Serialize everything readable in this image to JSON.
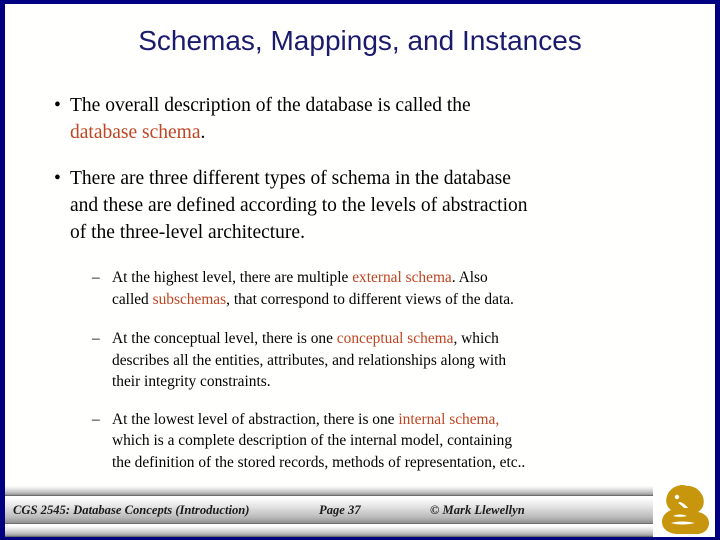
{
  "slide": {
    "title": "Schemas, Mappings, and Instances",
    "title_color": "#1b1b6e",
    "highlight_color": "#bf4422",
    "frame_color": "#000080",
    "background": "#fffffd"
  },
  "bullets": [
    {
      "marker": "•",
      "level": 1,
      "lines": [
        [
          {
            "text": "The  overall  description  of  the  database  is  called  the",
            "color": "default"
          }
        ],
        [
          {
            "text": "database schema",
            "color": "highlight"
          },
          {
            "text": ".",
            "color": "default"
          }
        ]
      ]
    },
    {
      "marker": "•",
      "level": 1,
      "lines": [
        [
          {
            "text": "There are three different types of schema in the database",
            "color": "default"
          }
        ],
        [
          {
            "text": "and these are defined according to the levels of abstraction",
            "color": "default"
          }
        ],
        [
          {
            "text": "of the three-level architecture.",
            "color": "default"
          }
        ]
      ]
    },
    {
      "marker": "–",
      "level": 2,
      "lines": [
        [
          {
            "text": "At  the  highest  level,  there  are  multiple  ",
            "color": "default"
          },
          {
            "text": "external  schema",
            "color": "highlight"
          },
          {
            "text": ".   Also",
            "color": "default"
          }
        ],
        [
          {
            "text": "called ",
            "color": "default"
          },
          {
            "text": "subschemas",
            "color": "highlight"
          },
          {
            "text": ", that correspond to different views of the data.",
            "color": "default"
          }
        ]
      ]
    },
    {
      "marker": "–",
      "level": 2,
      "lines": [
        [
          {
            "text": "At  the  conceptual  level,  there  is  one  ",
            "color": "default"
          },
          {
            "text": "conceptual  schema",
            "color": "highlight"
          },
          {
            "text": ",  which",
            "color": "default"
          }
        ],
        [
          {
            "text": "describes  all  the  entities,  attributes,  and  relationships  along  with",
            "color": "default"
          }
        ],
        [
          {
            "text": "their integrity constraints.",
            "color": "default"
          }
        ]
      ]
    },
    {
      "marker": "–",
      "level": 2,
      "lines": [
        [
          {
            "text": "At  the  lowest  level  of  abstraction,  there  is  one  ",
            "color": "default"
          },
          {
            "text": "internal  schema,",
            "color": "highlight"
          }
        ],
        [
          {
            "text": "which  is  a  complete  description  of  the  internal  model,  containing",
            "color": "default"
          }
        ],
        [
          {
            "text": "the definition of the stored records, methods of representation, etc..",
            "color": "default"
          }
        ]
      ]
    }
  ],
  "footer": {
    "course": "CGS 2545: Database Concepts  (Introduction)",
    "page": "Page 37",
    "author": "© Mark Llewellyn",
    "logo_name": "ucf-pegasus-logo",
    "logo_color": "#c8960c"
  }
}
